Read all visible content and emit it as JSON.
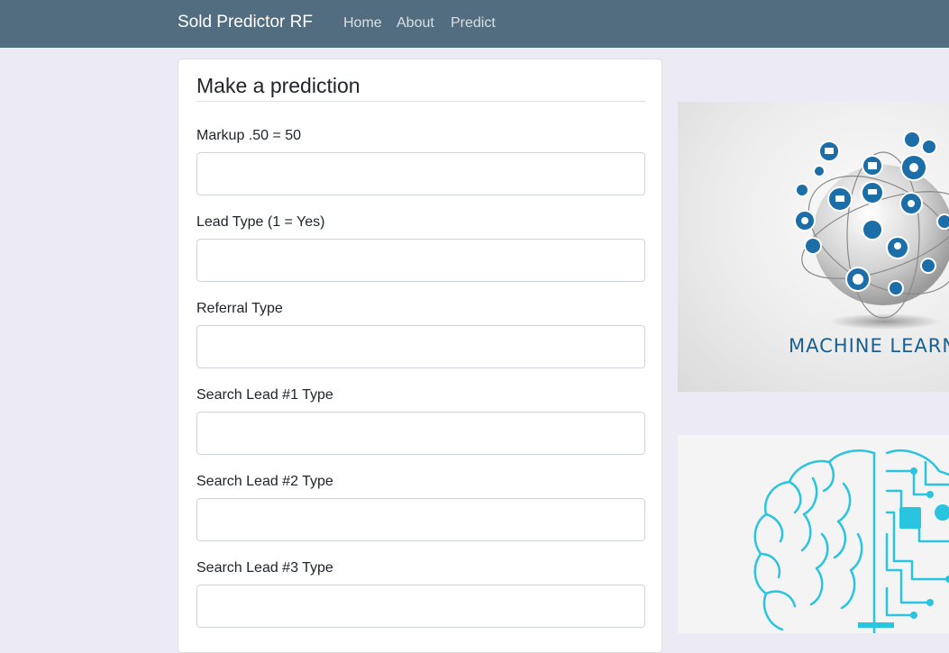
{
  "navbar": {
    "brand": "Sold Predictor RF",
    "links": [
      "Home",
      "About",
      "Predict"
    ]
  },
  "form": {
    "title": "Make a prediction",
    "fields": [
      {
        "label": "Markup .50 = 50",
        "value": ""
      },
      {
        "label": "Lead Type (1 = Yes)",
        "value": ""
      },
      {
        "label": "Referral Type",
        "value": ""
      },
      {
        "label": "Search Lead #1 Type",
        "value": ""
      },
      {
        "label": "Search Lead #2 Type",
        "value": ""
      },
      {
        "label": "Search Lead #3 Type",
        "value": ""
      }
    ]
  },
  "images": {
    "ml_caption": "MACHINE LEARN",
    "brain_icon": "brain-circuit-icon",
    "globe_icon": "tech-globe-icon"
  },
  "colors": {
    "navbar": "#536d80",
    "page_background": "#ecebf5",
    "ml_text": "#1a5f8f",
    "brain_line": "#29c4e0"
  }
}
